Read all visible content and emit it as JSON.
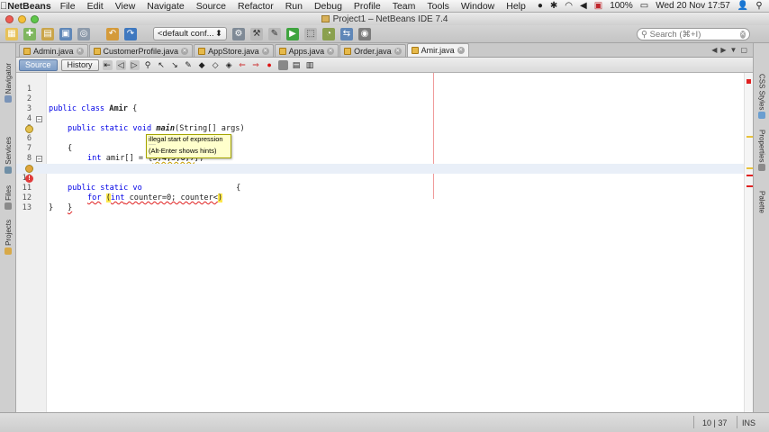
{
  "menubar": {
    "app_name": "NetBeans",
    "items": [
      "File",
      "Edit",
      "View",
      "Navigate",
      "Source",
      "Refactor",
      "Run",
      "Debug",
      "Profile",
      "Team",
      "Tools",
      "Window",
      "Help"
    ],
    "battery": "100%",
    "datetime": "Wed 20 Nov  17:57"
  },
  "window": {
    "title": "Project1 – NetBeans IDE 7.4"
  },
  "toolbar": {
    "config_value": "<default conf...",
    "search_placeholder": "Search (⌘+I)"
  },
  "left_panels": [
    "Navigator",
    "Services",
    "Files",
    "Projects"
  ],
  "right_panels": [
    "CSS Styles",
    "Properties",
    "Palette"
  ],
  "editor_tabs": [
    {
      "label": "Admin.java",
      "active": false
    },
    {
      "label": "CustomerProfile.java",
      "active": false
    },
    {
      "label": "AppStore.java",
      "active": false
    },
    {
      "label": "Apps.java",
      "active": false
    },
    {
      "label": "Order.java",
      "active": false
    },
    {
      "label": "Amir.java",
      "active": true
    }
  ],
  "editor_toolbar": {
    "source_label": "Source",
    "history_label": "History"
  },
  "code": {
    "line_numbers": [
      "1",
      "2",
      "3",
      "4",
      "5",
      "6",
      "7",
      "8",
      "9",
      "10",
      "11",
      "12",
      "13"
    ],
    "l2_kw": "public class ",
    "l2_name": "Amir",
    "l2_rest": " {",
    "l4_kw": "public static void ",
    "l4_name": "main",
    "l4_rest": "(String[] args)",
    "l5": "{",
    "l6_kw": "int",
    "l6_rest": " amir[] = {",
    "l6_vals": "3,4,5,6,7",
    "l6_end": "};",
    "l8": "}",
    "l9_kw": "public static vo",
    "l9_rest": "  {",
    "l10_kw": "for",
    "l10_p1": " ",
    "l10_paren_open": "(",
    "l10_int": "int",
    "l10_mid": " counter=0; counter<",
    "l10_paren_close": ")",
    "l11": "}",
    "l12": "}"
  },
  "tooltip": {
    "message": "illegal start of expression",
    "separator": "----",
    "hint": "(Alt-Enter shows hints)"
  },
  "status": {
    "caret": "10 | 37",
    "mode": "INS"
  }
}
